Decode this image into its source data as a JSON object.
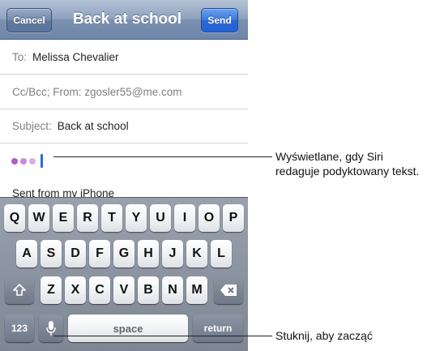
{
  "navbar": {
    "cancel_label": "Cancel",
    "title": "Back at school",
    "send_label": "Send"
  },
  "fields": {
    "to_label": "To:",
    "to_value": "Melissa Chevalier",
    "ccbcc_text": "Cc/Bcc; From: zgosler55@me.com",
    "subject_label": "Subject:",
    "subject_value": "Back at school"
  },
  "body": {
    "signature": "Sent from my iPhone"
  },
  "keyboard": {
    "row1": [
      "Q",
      "W",
      "E",
      "R",
      "T",
      "Y",
      "U",
      "I",
      "O",
      "P"
    ],
    "row2": [
      "A",
      "S",
      "D",
      "F",
      "G",
      "H",
      "J",
      "K",
      "L"
    ],
    "row3": [
      "Z",
      "X",
      "C",
      "V",
      "B",
      "N",
      "M"
    ],
    "numbers_label": "123",
    "space_label": "space",
    "return_label": "return",
    "shift_icon": "shift-arrow-icon",
    "delete_icon": "backspace-icon",
    "mic_icon": "microphone-icon"
  },
  "callouts": {
    "dictation_note": "Wyświetlane, gdy Siri redaguje podyktowany tekst.",
    "mic_note": "Stuknij, aby zacząć"
  },
  "colors": {
    "send_button": "#2f6fdc",
    "dictation_dots": "#b05ec2",
    "cursor": "#3366dd"
  }
}
